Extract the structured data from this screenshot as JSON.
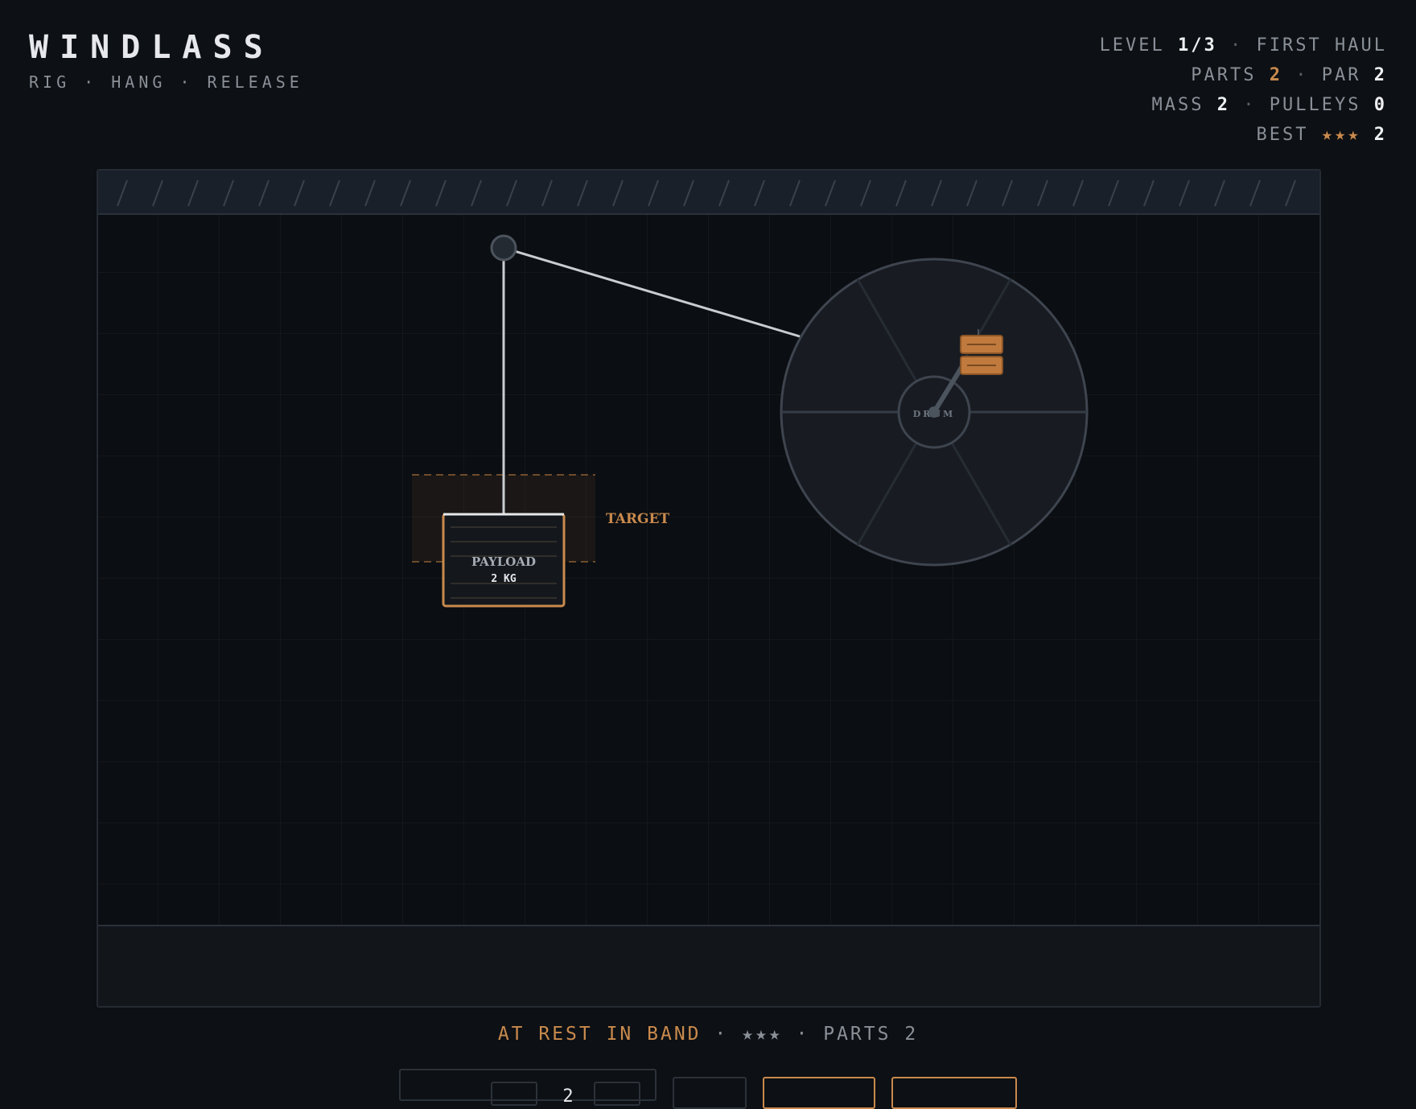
{
  "header": {
    "title": "WINDLASS",
    "subtitle": "RIG · HANG · RELEASE"
  },
  "stats": {
    "level_label": "LEVEL",
    "level_value": "1/3",
    "level_name": "FIRST HAUL",
    "parts_label": "PARTS",
    "parts_value": "2",
    "par_label": "PAR",
    "par_value": "2",
    "mass_label": "MASS",
    "mass_value": "2",
    "pulleys_label": "PULLEYS",
    "pulleys_value": "0",
    "best_label": "BEST",
    "best_stars": "★★★",
    "best_value": "2",
    "separator": "·"
  },
  "board": {
    "target_label": "TARGET",
    "payload_label": "PAYLOAD",
    "payload_mass": "2 KG",
    "drum_label": "DRUM"
  },
  "status": {
    "state": "AT REST IN BAND",
    "stars": "★★★",
    "parts": "PARTS 2",
    "separator": "·"
  },
  "controls": {
    "stepper_value": "2"
  },
  "colors": {
    "accent": "#c98a4d",
    "background": "#0d1014",
    "rope": "#c9ccd0",
    "wheel": "#1a1e24"
  }
}
